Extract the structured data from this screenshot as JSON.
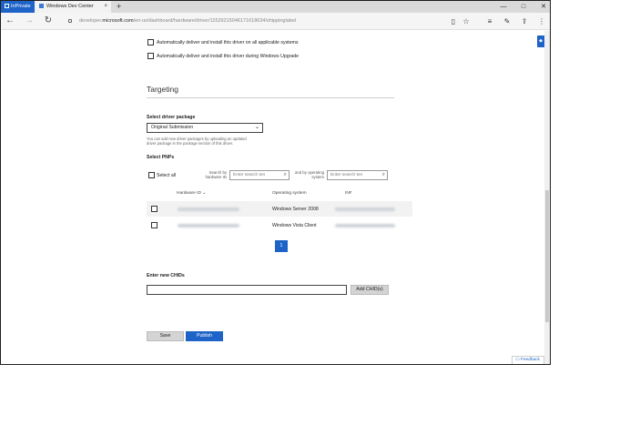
{
  "browser": {
    "inprivate_label": "InPrivate",
    "tab_title": "Windows Dev Center",
    "tab_close": "×",
    "new_tab": "+",
    "url_prefix": "developer.",
    "url_domain": "microsoft.com",
    "url_path": "/en-us/dashboard/hardware/driver/11529215046171618634/shippinglabel",
    "window_controls": {
      "minimize": "—",
      "maximize": "□",
      "close": "✕"
    }
  },
  "options": {
    "auto_deliver_all": "Automatically deliver and install this driver on all applicable systems",
    "auto_deliver_upgrade": "Automatically deliver and install this driver during Windows Upgrade"
  },
  "targeting": {
    "title": "Targeting",
    "select_package_label": "Select driver package",
    "package_value": "Original Submission",
    "help_text": "You can add new driver packages by uploading an updated driver package in the package section of this driver.",
    "select_pnps_label": "Select PNPs",
    "select_all_label": "Select all",
    "search_hwid_label": "Search by hardware ID",
    "search_os_label": "and by operating system",
    "search_placeholder": "Enter search ten",
    "columns": {
      "hardware_id": "Hardware ID",
      "os": "Operating system",
      "inf": "INF"
    },
    "rows": [
      {
        "os": "Windows Server 2008"
      },
      {
        "os": "Windows Vista Client"
      }
    ],
    "page_number": "1"
  },
  "chids": {
    "label": "Enter new CHIDs",
    "add_button": "Add CHID(s)"
  },
  "actions": {
    "save": "Save",
    "publish": "Publish",
    "feedback": "Feedback"
  }
}
